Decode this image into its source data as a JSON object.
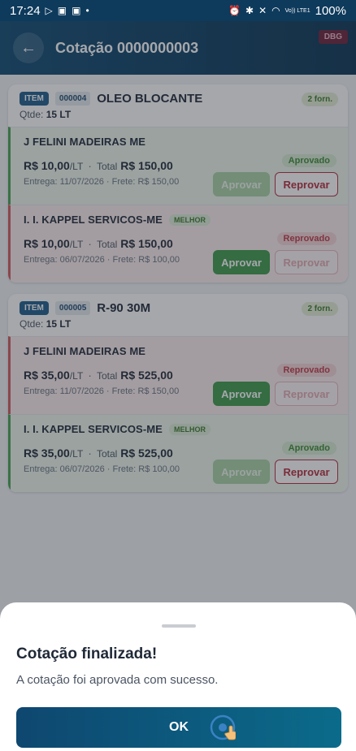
{
  "status_bar": {
    "time": "17:24",
    "left_icons": [
      "play-store-icon",
      "photo-icon",
      "photo-icon",
      "dot-icon"
    ],
    "right_icons": [
      "alarm-icon",
      "bluetooth-icon",
      "mute-icon",
      "wifi-icon"
    ],
    "network": "Vo)) LTE1",
    "battery": "100%"
  },
  "header": {
    "back_icon": "arrow-left-icon",
    "title": "Cotação 0000000003",
    "debug_badge": "DBG"
  },
  "items": [
    {
      "chip": "ITEM",
      "code": "000004",
      "name": "OLEO BLOCANTE",
      "forn": "2 forn.",
      "qty_label": "Qtde:",
      "qty_value": "15 LT",
      "offers": [
        {
          "supplier": "J FELINI MADEIRAS ME",
          "best": "",
          "status": "Aprovado",
          "unit_price": "R$ 10,00",
          "unit": "/LT",
          "total_label": "Total",
          "total": "R$ 150,00",
          "entrega": "Entrega: 11/07/2026 · Frete: R$ 150,00",
          "approve_label": "Aprovar",
          "reject_label": "Reprovar"
        },
        {
          "supplier": "I. I. KAPPEL SERVICOS-ME",
          "best": "MELHOR",
          "status": "Reprovado",
          "unit_price": "R$ 10,00",
          "unit": "/LT",
          "total_label": "Total",
          "total": "R$ 150,00",
          "entrega": "Entrega: 06/07/2026 · Frete: R$ 100,00",
          "approve_label": "Aprovar",
          "reject_label": "Reprovar"
        }
      ]
    },
    {
      "chip": "ITEM",
      "code": "000005",
      "name": "R-90 30M",
      "forn": "2 forn.",
      "qty_label": "Qtde:",
      "qty_value": "15 LT",
      "offers": [
        {
          "supplier": "J FELINI MADEIRAS ME",
          "best": "",
          "status": "Reprovado",
          "unit_price": "R$ 35,00",
          "unit": "/LT",
          "total_label": "Total",
          "total": "R$ 525,00",
          "entrega": "Entrega: 11/07/2026 · Frete: R$ 150,00",
          "approve_label": "Aprovar",
          "reject_label": "Reprovar"
        },
        {
          "supplier": "I. I. KAPPEL SERVICOS-ME",
          "best": "MELHOR",
          "status": "Aprovado",
          "unit_price": "R$ 35,00",
          "unit": "/LT",
          "total_label": "Total",
          "total": "R$ 525,00",
          "entrega": "Entrega: 06/07/2026 · Frete: R$ 100,00",
          "approve_label": "Aprovar",
          "reject_label": "Reprovar"
        }
      ]
    }
  ],
  "sheet": {
    "title": "Cotação finalizada!",
    "message": "A cotação foi aprovada com sucesso.",
    "ok_label": "OK"
  },
  "colors": {
    "header": "#0f4a72",
    "approve": "#3f9a4a",
    "reject": "#b52c3b"
  }
}
